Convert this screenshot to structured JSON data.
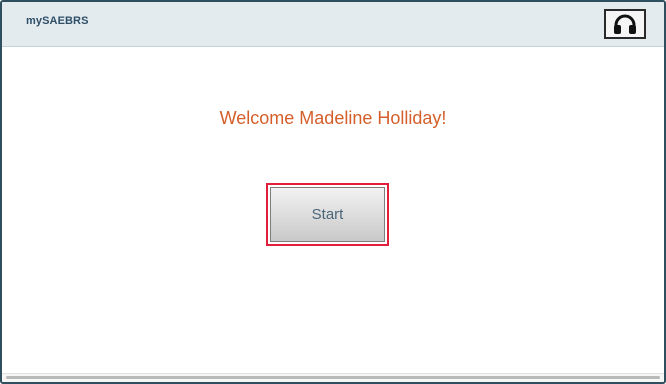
{
  "header": {
    "app_title": "mySAEBRS",
    "audio_icon": "headphones-icon"
  },
  "main": {
    "welcome_text": "Welcome Madeline Holliday!",
    "start_label": "Start"
  },
  "colors": {
    "header_bg": "#e4ebef",
    "welcome_text": "#d45f2a",
    "focus_outline": "#e21f3a",
    "title_text": "#2e4f68"
  }
}
